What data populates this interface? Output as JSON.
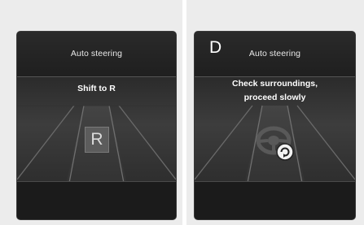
{
  "left_screen": {
    "title": "Auto steering",
    "message": "Shift to R",
    "gear_indicator": "R"
  },
  "right_screen": {
    "gear": "D",
    "title": "Auto steering",
    "message_line1": "Check surroundings,",
    "message_line2": "proceed slowly",
    "icon": "steering-wheel-rotate-icon"
  }
}
